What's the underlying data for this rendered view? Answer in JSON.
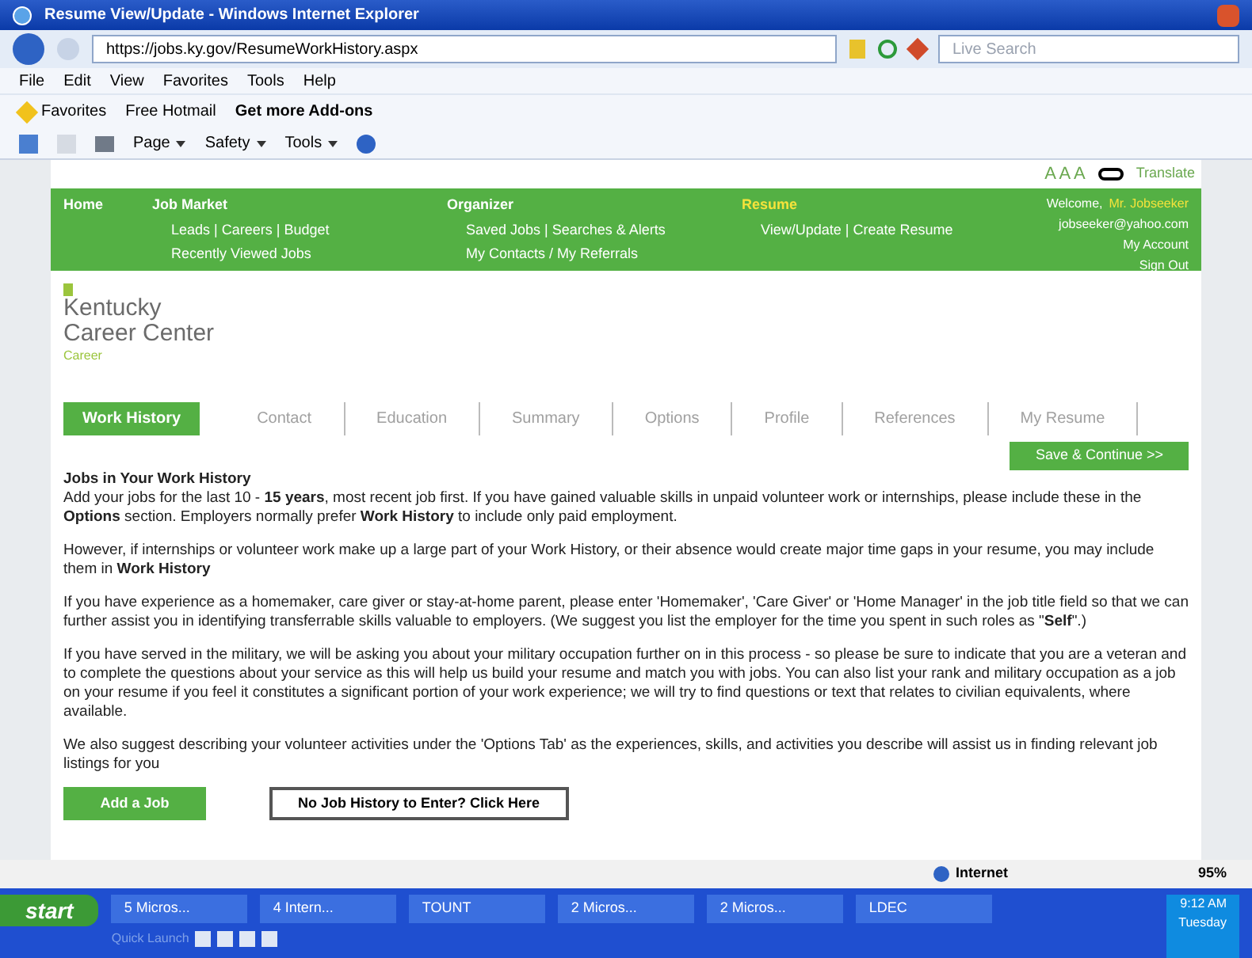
{
  "window": {
    "title": "Resume View/Update - Windows Internet Explorer"
  },
  "address_bar": {
    "url": "https://jobs.ky.gov/ResumeWorkHistory.aspx"
  },
  "search": {
    "placeholder": "Live Search"
  },
  "menu": [
    "File",
    "Edit",
    "View",
    "Favorites",
    "Tools",
    "Help"
  ],
  "favorites_bar": {
    "label": "Favorites",
    "links": [
      "Free Hotmail",
      "Get more Add-ons"
    ]
  },
  "command_bar": [
    "Page",
    "Safety",
    "Tools"
  ],
  "site": {
    "accessibility": {
      "text_sizes": "A A A",
      "translate": "Translate"
    },
    "nav": {
      "home": "Home",
      "columns": [
        {
          "title": "Job Market",
          "selected": false,
          "links": [
            "Leads | Careers | Budget",
            "Recently Viewed Jobs"
          ]
        },
        {
          "title": "Organizer",
          "selected": false,
          "links": [
            "Saved Jobs | Searches & Alerts",
            "My Contacts / My Referrals"
          ]
        },
        {
          "title": "Resume",
          "selected": true,
          "links": [
            "View/Update | Create Resume"
          ]
        }
      ],
      "user": {
        "greeting": "Welcome,",
        "name": "Mr. Jobseeker",
        "email": "jobseeker@yahoo.com",
        "links": [
          "My Account",
          "Sign Out"
        ]
      }
    },
    "logo": {
      "line1": "Kentucky",
      "line2": "Career Center",
      "tagline": "Career"
    },
    "tabs": [
      {
        "label": "Work History",
        "selected": true
      },
      {
        "label": "Contact",
        "selected": false
      },
      {
        "label": "Education",
        "selected": false
      },
      {
        "label": "Summary",
        "selected": false
      },
      {
        "label": "Options",
        "selected": false
      },
      {
        "label": "Profile",
        "selected": false
      },
      {
        "label": "References",
        "selected": false
      },
      {
        "label": "My Resume",
        "selected": false
      }
    ],
    "save_button": "Save & Continue >>",
    "heading": "Jobs in Your Work History",
    "paragraphs": [
      "Add your jobs for the last 10 - **15 years**, most recent job first. If you have gained valuable skills in unpaid volunteer work or internships, please include these in the **Options** section. Employers normally prefer **Work History** to include only paid employment.",
      "However, if internships or volunteer work make up a large part of your Work History, or their absence would create major time gaps in your resume, you may include them in **Work History**",
      "If you have experience as a homemaker, care giver or stay-at-home parent, please enter 'Homemaker', 'Care Giver' or 'Home Manager' in the job title field so that we can further assist you in identifying transferrable skills valuable to employers. (We suggest you list the employer for the time you spent in such roles as \"**Self**\".)",
      "If you have served in the military, we will be asking you about your military occupation further on in this process - so please be sure to indicate that you are a veteran and to complete the questions about your service as this will help us build your resume and match you with jobs. You can also list your rank and military occupation as a job on your resume if you feel it constitutes a significant portion of your work experience; we will try to find questions or text that relates to civilian equivalents, where available.",
      "We also suggest describing your volunteer activities under the 'Options Tab' as the experiences, skills, and activities you describe will assist us in finding relevant job listings for you"
    ],
    "buttons": [
      {
        "label": "Add a Job",
        "kind": "primary"
      },
      {
        "label": "No Job History to Enter? Click Here",
        "kind": "outline"
      }
    ]
  },
  "status_bar": {
    "zone": "Internet",
    "zoom": "95%"
  },
  "taskbar": {
    "start": "start",
    "tasks": [
      "5 Micros...",
      "4 Intern...",
      "TOUNT",
      "2 Micros...",
      "2 Micros...",
      "LDEC"
    ],
    "quick_launch": "Quick Launch",
    "clock": {
      "time": "9:12 AM",
      "day": "Tuesday"
    }
  }
}
